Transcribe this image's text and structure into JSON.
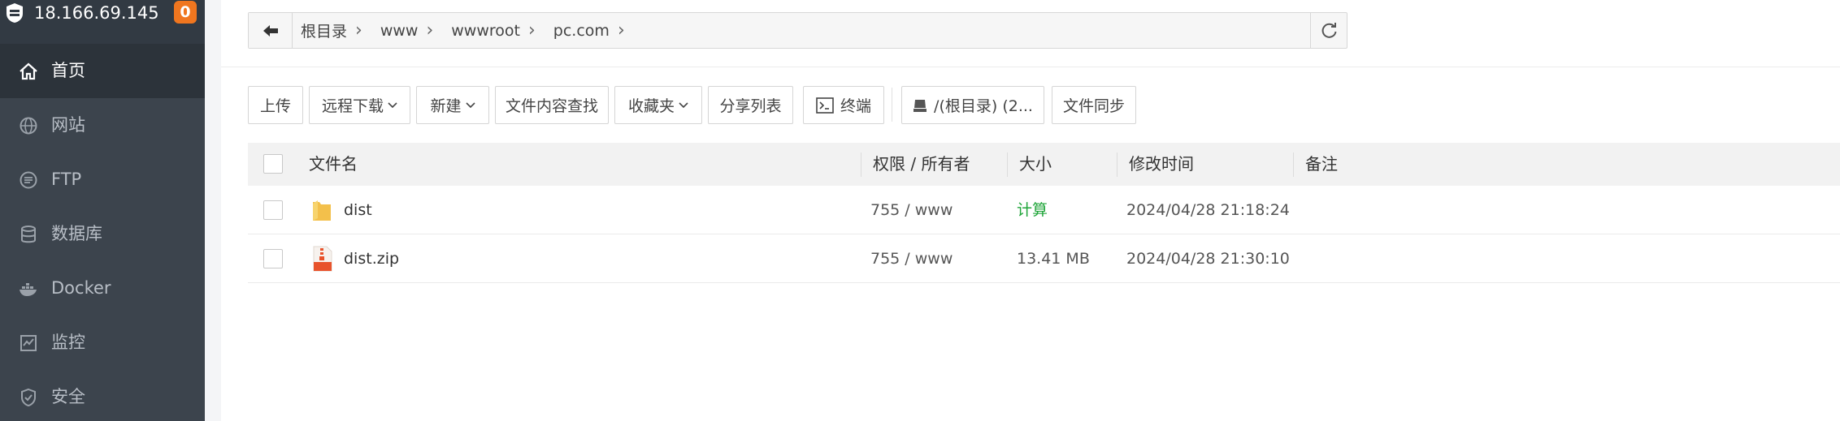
{
  "server": {
    "ip": "18.166.69.145",
    "badge": "0"
  },
  "sidebar": {
    "items": [
      {
        "label": "首页",
        "icon": "home-icon",
        "active": true
      },
      {
        "label": "网站",
        "icon": "globe-icon",
        "active": false
      },
      {
        "label": "FTP",
        "icon": "ftp-icon",
        "active": false
      },
      {
        "label": "数据库",
        "icon": "database-icon",
        "active": false
      },
      {
        "label": "Docker",
        "icon": "docker-icon",
        "active": false
      },
      {
        "label": "监控",
        "icon": "monitor-icon",
        "active": false
      },
      {
        "label": "安全",
        "icon": "shield-icon",
        "active": false
      }
    ]
  },
  "path": {
    "crumbs": [
      "根目录",
      "www",
      "wwwroot",
      "pc.com"
    ]
  },
  "toolbar": {
    "upload": "上传",
    "remote_download": "远程下载",
    "new": "新建",
    "content_search": "文件内容查找",
    "favorites": "收藏夹",
    "share_list": "分享列表",
    "terminal": "终端",
    "disk": "/(根目录) (2...",
    "file_sync": "文件同步"
  },
  "table": {
    "headers": {
      "name": "文件名",
      "perm": "权限 / 所有者",
      "size": "大小",
      "mtime": "修改时间",
      "note": "备注"
    },
    "rows": [
      {
        "name": "dist",
        "type": "folder",
        "perm": "755 / www",
        "size": "计算",
        "mtime": "2024/04/28 21:18:24"
      },
      {
        "name": "dist.zip",
        "type": "zip",
        "perm": "755 / www",
        "size": "13.41 MB",
        "mtime": "2024/04/28 21:30:10"
      }
    ]
  },
  "colors": {
    "sidebar_bg": "#3c444d",
    "sidebar_active": "#2c333a",
    "badge": "#f0761f",
    "calc_link": "#20a53a"
  }
}
